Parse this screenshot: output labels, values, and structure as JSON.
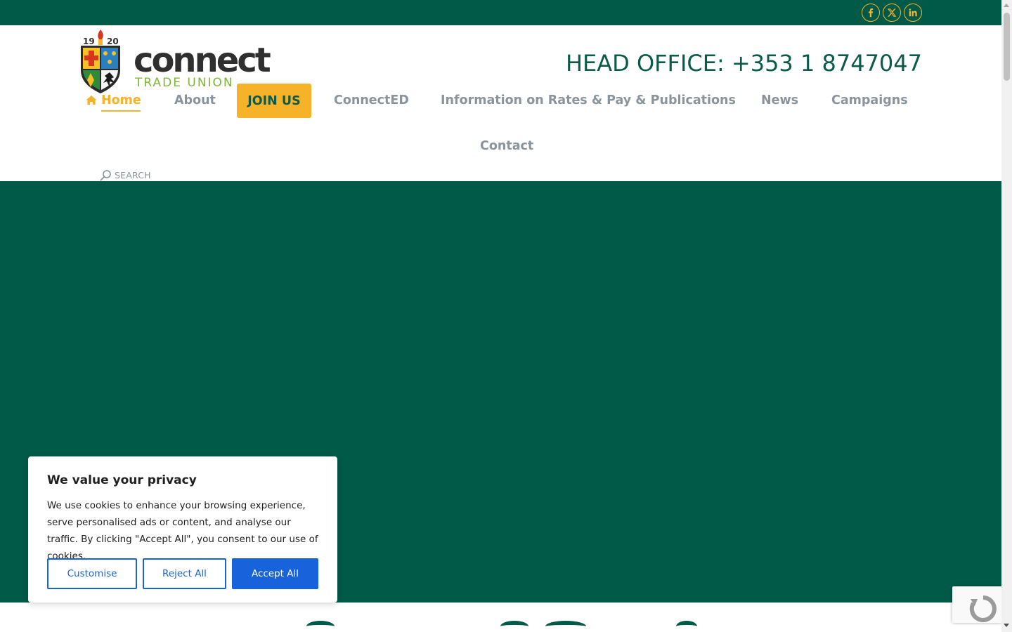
{
  "colors": {
    "brand_green": "#015a48",
    "accent_yellow": "#f6b229",
    "nav_grey": "#8a949c",
    "cookie_blue": "#1863dc"
  },
  "social": [
    {
      "icon": "facebook-icon"
    },
    {
      "icon": "x-twitter-icon"
    },
    {
      "icon": "linkedin-icon"
    }
  ],
  "logo": {
    "year_left": "19",
    "year_right": "20",
    "name": "connect",
    "tagline": "TRADE UNION"
  },
  "header": {
    "head_office": "HEAD OFFICE: +353 1 8747047"
  },
  "nav": {
    "home": "Home",
    "about": "About",
    "join": "JOIN US",
    "connected": "ConnectED",
    "rates": "Information on Rates & Pay & Publications",
    "news": "News",
    "campaigns": "Campaigns",
    "contact": "Contact",
    "active": "Home"
  },
  "search": {
    "label": "SEARCH"
  },
  "cookie": {
    "title": "We value your privacy",
    "text": "We use cookies to enhance your browsing experience, serve personalised ads or content, and analyse our traffic. By clicking \"Accept All\", you consent to our use of cookies.",
    "customise": "Customise",
    "reject": "Reject All",
    "accept": "Accept All"
  }
}
